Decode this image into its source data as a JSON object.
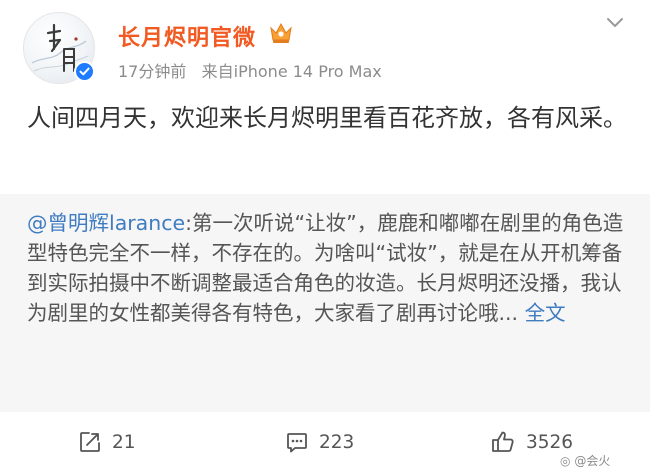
{
  "author": {
    "name": "长月烬明官微",
    "avatar_text": "长月烬明",
    "crown_badge": "crown-icon",
    "verified_badge": "verified-icon",
    "verified_color": "#1f7bff"
  },
  "meta": {
    "time": "17分钟前",
    "source": "来自iPhone 14 Pro Max"
  },
  "post": {
    "text": "人间四月天，欢迎来长月烬明里看百花齐放，各有风采。"
  },
  "repost": {
    "mention": "@曾明辉larance",
    "text": ":第一次听说“让妆”，鹿鹿和嘟嘟在剧里的角色造型特色完全不一样，不存在的。为啥叫“试妆”，就是在从开机筹备到实际拍摄中不断调整最适合角色的妆造。长月烬明还没播，我认为剧里的女性都美得各有特色，大家看了剧再讨论哦...",
    "more_label": "全文"
  },
  "actions": {
    "repost_count": "21",
    "comment_count": "223",
    "like_count": "3526"
  },
  "watermark": "@会火",
  "colors": {
    "username": "#f15a22",
    "link": "#3f7cc1",
    "repost_bg": "#f6f6f6"
  }
}
